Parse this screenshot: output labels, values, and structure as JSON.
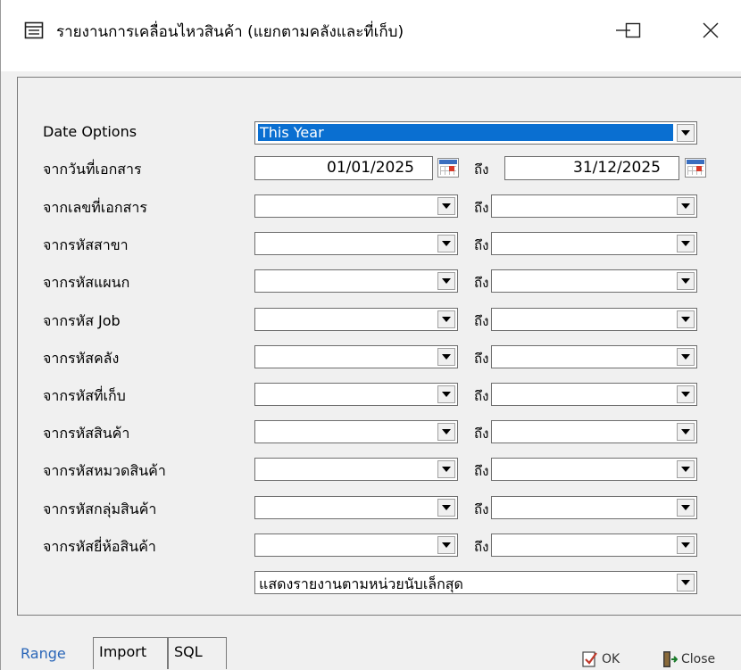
{
  "window": {
    "title": "รายงานการเคลื่อนไหวสินค้า (แยกตามคลังและที่เก็บ)",
    "controls": {
      "minimize": "—",
      "maximize": "☐",
      "close": "✕"
    }
  },
  "form": {
    "date_options_label": "Date Options",
    "date_options_value": "This Year",
    "doc_date_label": "จากวันที่เอกสาร",
    "to_label": "ถึง",
    "date_from": "01/01/2025",
    "date_to": "31/12/2025",
    "rows": [
      {
        "label": "จากเลขที่เอกสาร"
      },
      {
        "label": "จากรหัสสาขา"
      },
      {
        "label": "จากรหัสแผนก"
      },
      {
        "label": "จากรหัส Job"
      },
      {
        "label": "จากรหัสคลัง"
      },
      {
        "label": "จากรหัสที่เก็บ"
      },
      {
        "label": "จากรหัสสินค้า"
      },
      {
        "label": "จากรหัสหมวดสินค้า"
      },
      {
        "label": "จากรหัสกลุ่มสินค้า"
      },
      {
        "label": "จากรหัสยี่ห้อสินค้า"
      }
    ],
    "unit_option_value": "แสดงรายงานตามหน่วยนับเล็กสุด"
  },
  "tabs": {
    "range": "Range",
    "import": "Import",
    "sql": "SQL"
  },
  "buttons": {
    "ok": "OK",
    "close": "Close"
  }
}
